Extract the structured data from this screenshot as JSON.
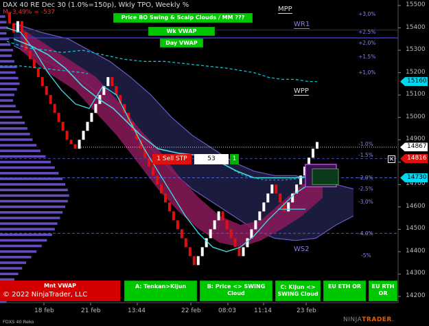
{
  "header": {
    "title": "DAX 40 RE Dec 30 (1.0%=150p), Wkly TPO, Weekly %",
    "subtitle": "M -3,49% = -537"
  },
  "buttons": {
    "price_bo": "Price BO Swing & Scalp Clouds / MM ???",
    "wk_vwap": "Wk VWAP",
    "day_vwap": "Day VWAP",
    "mnt_vwap": "Mnt VWAP",
    "tenkan": "A: Tenkan>Kijun",
    "price_swing": "B: Price <> SWING Cloud",
    "kijun_swing_1": "C: Kijun <>",
    "kijun_swing_2": "SWING Cloud",
    "eu_eth": "EU ETH OR",
    "eu_rth": "EU RTH OR"
  },
  "order_bar": {
    "action": "1 Sell STP",
    "quantity": "53",
    "count": "1",
    "close_icon": "close-x-icon"
  },
  "copyright": "© 2022 NinjaTrader, LLC",
  "footer": {
    "instrument": "FDXS 40 Reko",
    "logo_prefix": "NINJA",
    "logo_suffix": "TRADER",
    "logo_tail": "."
  },
  "levels": {
    "mpp": "MPP",
    "wr1": "WR1",
    "wpp": "WPP",
    "ws2": "WS2"
  },
  "price_axis": [
    "15500",
    "15400",
    "15300",
    "15200",
    "15100",
    "15000",
    "14900",
    "14800",
    "14700",
    "14600",
    "14500",
    "14400",
    "14300",
    "14200"
  ],
  "pct_labels": [
    "+3,0%",
    "+2.5%",
    "+2,0%",
    "+1.5%",
    "+1,0%",
    "-1.0%",
    "-1.5%",
    "-2.0%",
    "-2.5%",
    "-3,0%",
    "-4.0%",
    "-5%"
  ],
  "price_tags": [
    {
      "value": "15160",
      "bg": "#00d8f0",
      "fg": "#000"
    },
    {
      "value": "14867",
      "bg": "#ffffff",
      "fg": "#000"
    },
    {
      "value": "14816",
      "bg": "#e01010",
      "fg": "#fff"
    },
    {
      "value": "14730",
      "bg": "#00d8f0",
      "fg": "#000"
    }
  ],
  "time_axis": [
    "18 feb",
    "21 feb",
    "13:44",
    "22 feb",
    "08:03",
    "11:14",
    "23 feb"
  ],
  "colors": {
    "up_bar": "#ffffff",
    "down_bar": "#e01010",
    "cloud_fast": "#8a1a5a",
    "cloud_slow": "#1e1e44",
    "kijun": "#4cd8e8",
    "vwap": "#00c8d8",
    "profile": "#6a4fc8",
    "pivot_line": "#7060d0"
  },
  "chart_data": {
    "type": "candlestick",
    "instrument": "DAX 40 RE Dec 30",
    "y_range": [
      14200,
      15500
    ],
    "price_ticks": [
      15500,
      15400,
      15300,
      15200,
      15100,
      15000,
      14900,
      14800,
      14700,
      14600,
      14500,
      14400,
      14300,
      14200
    ],
    "current_price": 14867,
    "order_price": 14816,
    "swing_cloud_price": 14730,
    "wpp_price": 15160,
    "bricks": [
      15470,
      15420,
      15380,
      15430,
      15380,
      15300,
      15260,
      15220,
      15180,
      15140,
      15100,
      15060,
      15020,
      14980,
      14940,
      14900,
      14880,
      14860,
      14900,
      14940,
      14980,
      15020,
      15060,
      15100,
      15140,
      15180,
      15140,
      15100,
      15060,
      15020,
      14980,
      14940,
      14900,
      14860,
      14820,
      14780,
      14740,
      14700,
      14660,
      14620,
      14580,
      14540,
      14500,
      14460,
      14420,
      14380,
      14340,
      14380,
      14420,
      14460,
      14500,
      14540,
      14580,
      14540,
      14500,
      14460,
      14420,
      14380,
      14420,
      14460,
      14500,
      14540,
      14580,
      14620,
      14660,
      14700,
      14660,
      14620,
      14580,
      14620,
      14660,
      14700,
      14740,
      14780,
      14820,
      14860,
      14890
    ]
  }
}
